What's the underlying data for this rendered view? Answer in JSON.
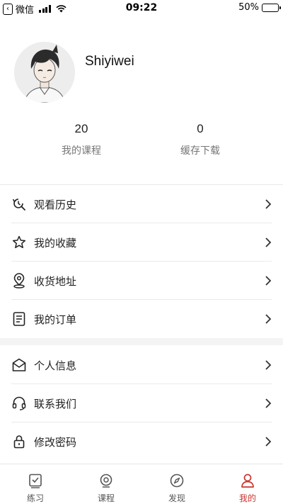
{
  "status_bar": {
    "back_app": "微信",
    "time": "09:22",
    "battery": "50%",
    "battery_level": 0.5
  },
  "profile": {
    "username": "Shiyiwei"
  },
  "stats": [
    {
      "value": "20",
      "label": "我的课程"
    },
    {
      "value": "0",
      "label": "缓存下载"
    }
  ],
  "menu_group_1": [
    {
      "label": "观看历史",
      "icon": "history-icon"
    },
    {
      "label": "我的收藏",
      "icon": "star-icon"
    },
    {
      "label": "收货地址",
      "icon": "location-pin-icon"
    },
    {
      "label": "我的订单",
      "icon": "order-list-icon"
    }
  ],
  "menu_group_2": [
    {
      "label": "个人信息",
      "icon": "envelope-icon"
    },
    {
      "label": "联系我们",
      "icon": "headset-icon"
    },
    {
      "label": "修改密码",
      "icon": "lock-icon"
    }
  ],
  "tabs": [
    {
      "label": "练习",
      "icon": "checkbox-icon"
    },
    {
      "label": "课程",
      "icon": "video-icon"
    },
    {
      "label": "发现",
      "icon": "compass-icon"
    },
    {
      "label": "我的",
      "icon": "person-icon",
      "active": true
    }
  ],
  "colors": {
    "accent": "#c8352f",
    "text": "#222222",
    "muted": "#777777",
    "divider": "#eaeaea"
  }
}
